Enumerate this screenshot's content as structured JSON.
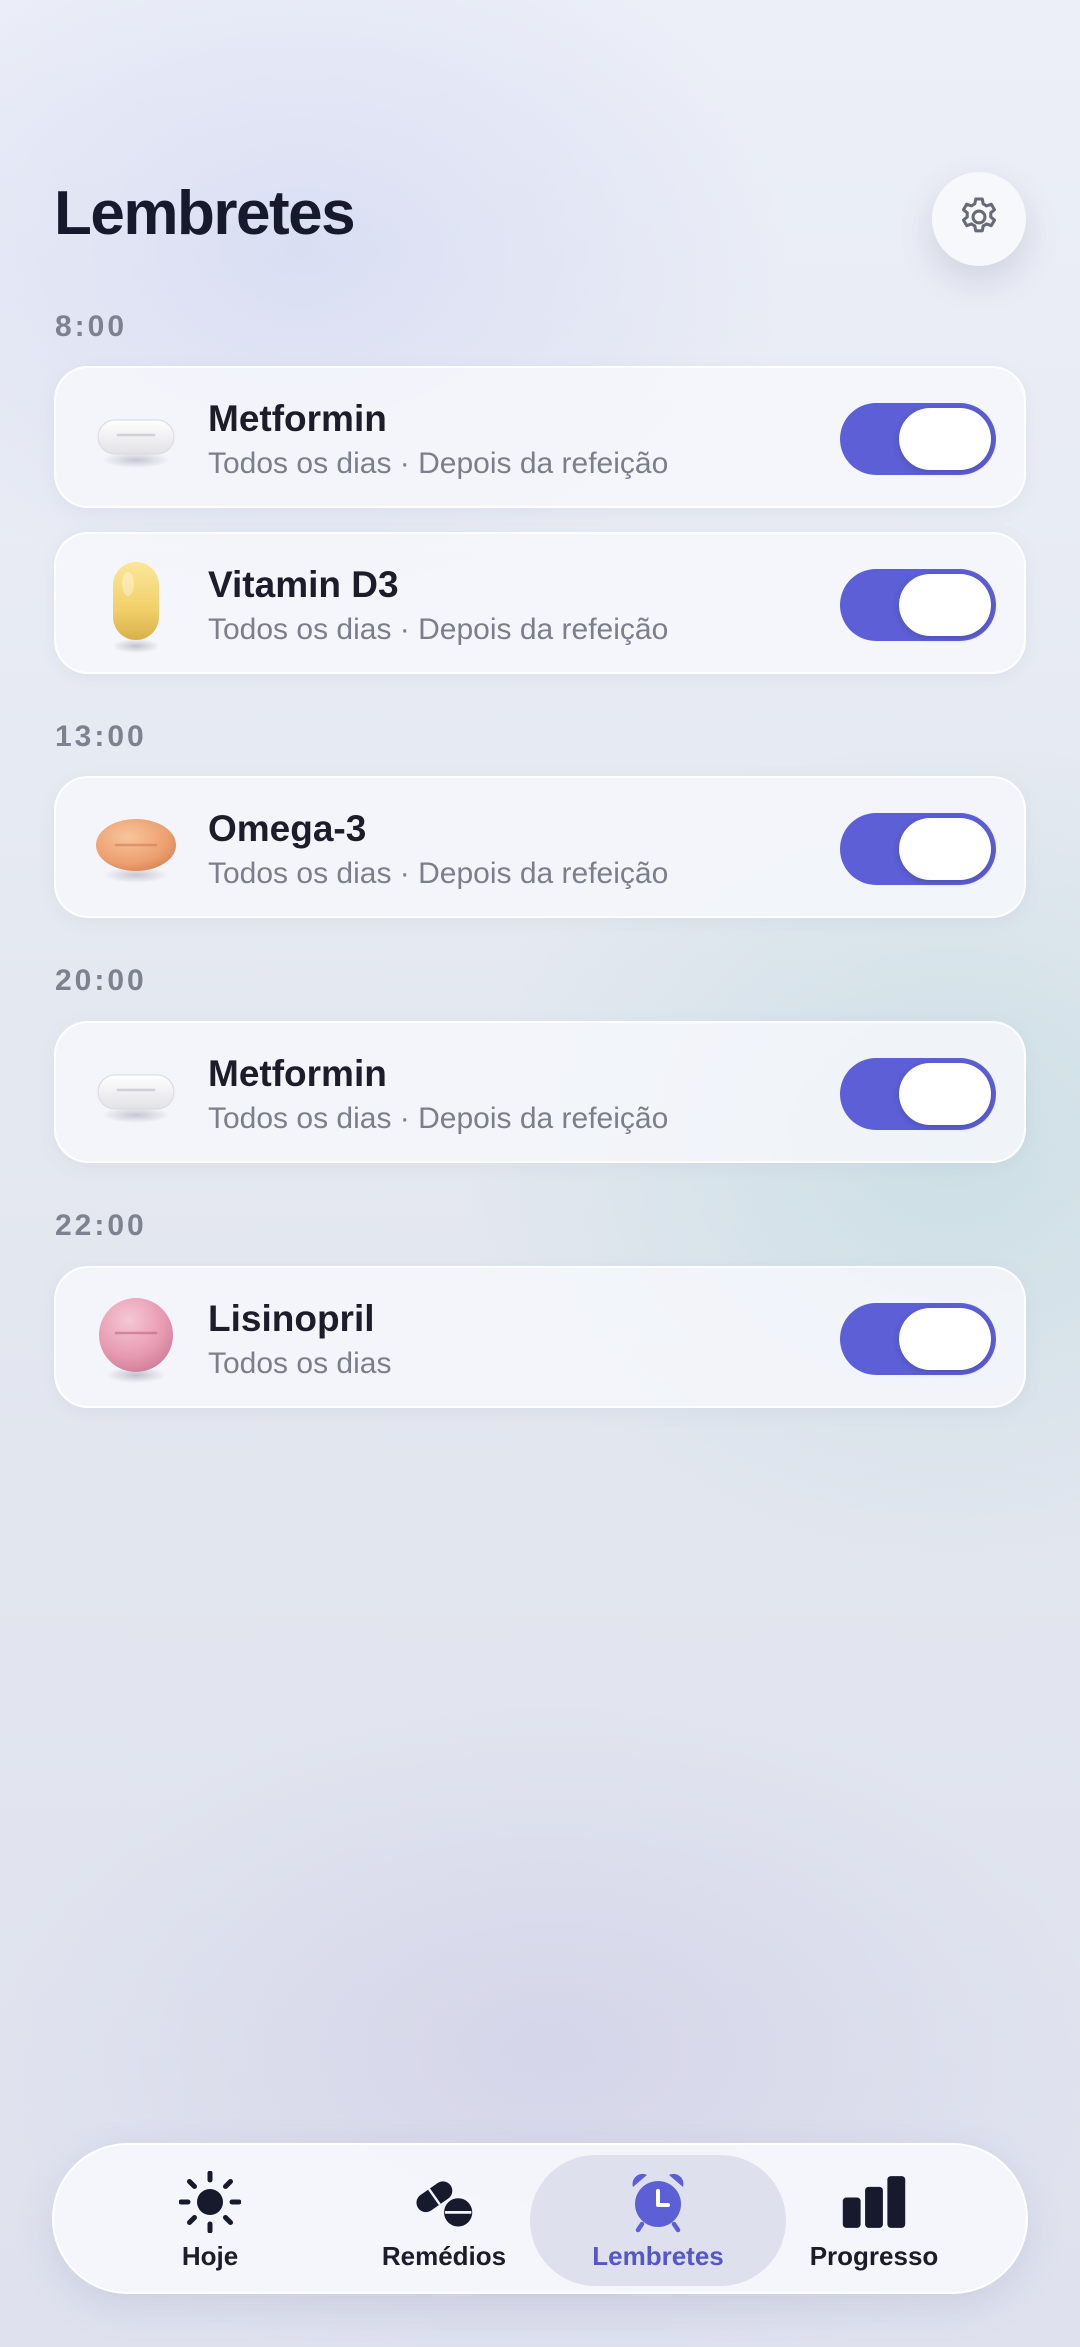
{
  "header": {
    "title": "Lembretes",
    "settings_icon": "gear-icon"
  },
  "groups": [
    {
      "time": "8:00",
      "items": [
        {
          "name": "Metformin",
          "schedule": "Todos os dias · Depois da refeição",
          "pill_icon": "white-oval-tablet-icon",
          "enabled": true
        },
        {
          "name": "Vitamin D3",
          "schedule": "Todos os dias · Depois da refeição",
          "pill_icon": "yellow-capsule-icon",
          "enabled": true
        }
      ]
    },
    {
      "time": "13:00",
      "items": [
        {
          "name": "Omega-3",
          "schedule": "Todos os dias · Depois da refeição",
          "pill_icon": "orange-softgel-icon",
          "enabled": true
        }
      ]
    },
    {
      "time": "20:00",
      "items": [
        {
          "name": "Metformin",
          "schedule": "Todos os dias · Depois da refeição",
          "pill_icon": "white-oval-tablet-icon",
          "enabled": true
        }
      ]
    },
    {
      "time": "22:00",
      "items": [
        {
          "name": "Lisinopril",
          "schedule": "Todos os dias",
          "pill_icon": "pink-round-tablet-icon",
          "enabled": true
        }
      ]
    }
  ],
  "tabbar": {
    "tabs": [
      {
        "label": "Hoje",
        "icon": "sun-icon",
        "active": false
      },
      {
        "label": "Remédios",
        "icon": "pills-icon",
        "active": false
      },
      {
        "label": "Lembretes",
        "icon": "alarm-clock-icon",
        "active": true
      },
      {
        "label": "Progresso",
        "icon": "bar-chart-icon",
        "active": false
      }
    ]
  },
  "colors": {
    "accent": "#5c5fd5",
    "active_tab_text": "#5457c4",
    "title": "#171a2c",
    "secondary_text": "#7b7f8c"
  }
}
